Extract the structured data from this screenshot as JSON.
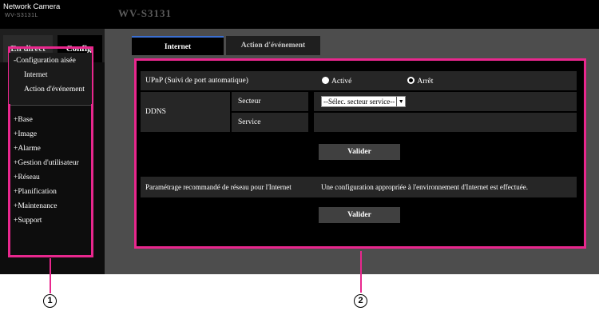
{
  "header": {
    "brand": "Network Camera",
    "brand_sub": "WV-S3131L",
    "model": "WV-S3131"
  },
  "side_tabs": {
    "live": "En direct",
    "config": "Config."
  },
  "side_menu": {
    "quick_setup": "-Configuration aisée",
    "sub_items": [
      "Internet",
      "Action d'événement"
    ],
    "items": [
      "+Base",
      "+Image",
      "+Alarme",
      "+Gestion d'utilisateur",
      "+Réseau",
      "+Planification",
      "+Maintenance",
      "+Support"
    ]
  },
  "tabs": [
    "Internet",
    "Action d'événement"
  ],
  "form": {
    "upnp_label": "UPnP (Suivi de port automatique)",
    "upnp_on": "Activé",
    "upnp_off": "Arrêt",
    "upnp_selected": "Arrêt",
    "ddns_label": "DDNS",
    "sector_label": "Secteur",
    "sector_value": "--Sélec. secteur service--",
    "service_label": "Service",
    "service_value": "",
    "apply1": "Valider",
    "recommended_label": "Paramétrage recommandé de réseau pour l'Internet",
    "recommended_desc": "Une configuration appropriée à l'environnement d'Internet est effectuée.",
    "apply2": "Valider"
  },
  "callouts": [
    "1",
    "2"
  ],
  "colors": {
    "highlight": "#e8278d",
    "tab_accent": "#3b6fd1",
    "background": "#4d4d4d"
  }
}
